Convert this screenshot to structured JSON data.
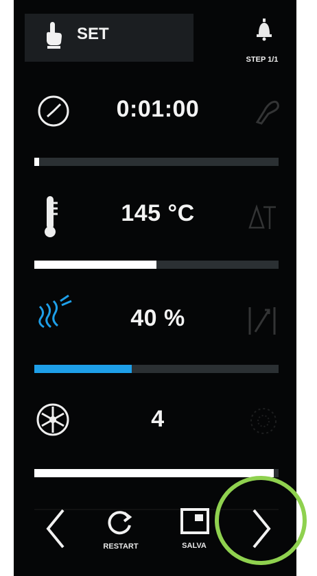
{
  "header": {
    "mode_label": "SET",
    "step_label": "STEP 1/1"
  },
  "rows": {
    "time": {
      "value": "0:01:00",
      "progress": 0.02
    },
    "temperature": {
      "value": "145 °C",
      "progress": 0.5
    },
    "humidity": {
      "value": "40 %",
      "progress": 0.4,
      "color": "#1e9fe8"
    },
    "fan": {
      "value": "4",
      "progress": 0.98
    }
  },
  "footer": {
    "restart_label": "RESTART",
    "save_label": "SALVA"
  },
  "colors": {
    "accent_blue": "#1e9fe8",
    "highlight_green": "#8fd14f",
    "fill_white": "#ffffff"
  }
}
